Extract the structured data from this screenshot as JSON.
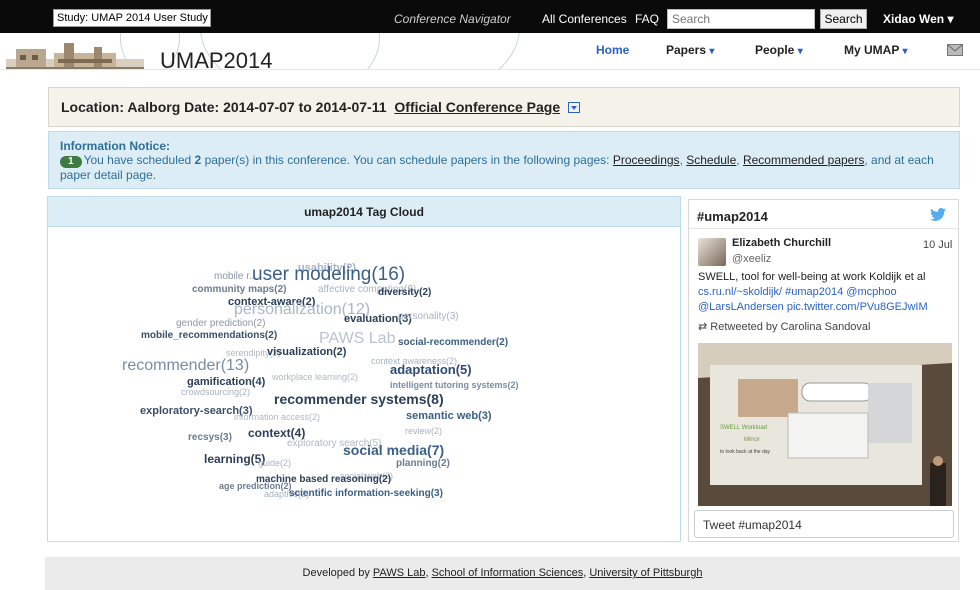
{
  "topbar": {
    "study_select": "Study: UMAP 2014 User Study",
    "conference_navigator": "Conference Navigator",
    "all_conferences": "All Conferences",
    "faq": "FAQ",
    "search_placeholder": "Search",
    "search_button": "Search",
    "user_name": "Xidao Wen ▾"
  },
  "header": {
    "title": "UMAP2014",
    "nav": {
      "home": "Home",
      "papers": "Papers",
      "people": "People",
      "my_umap": "My UMAP",
      "caret": "▾"
    }
  },
  "location": {
    "location_label": "Location:",
    "location_value": "Aalborg",
    "date_label": "Date:",
    "date_value": "2014-07-07 to 2014-07-11",
    "official_link": "Official Conference Page"
  },
  "notice": {
    "title": "Information Notice:",
    "badge": "1",
    "text_1": "You have scheduled ",
    "count": "2",
    "text_2": " paper(s) in this conference. You can schedule papers in the following pages: ",
    "link_proceedings": "Proceedings",
    "sep_1": ", ",
    "link_schedule": "Schedule",
    "sep_2": ", ",
    "link_recommended": "Recommended papers",
    "text_3": ", and at each paper detail page."
  },
  "tag_cloud": {
    "title": "umap2014 Tag Cloud",
    "tags": [
      {
        "label": "user modeling(16)",
        "color": "#3b5f86"
      },
      {
        "label": "mobile r...",
        "color": "#8a96a6"
      },
      {
        "label": "usability(2)",
        "color": "#a7b3c4"
      },
      {
        "label": "community maps(2)",
        "color": "#6b7c92"
      },
      {
        "label": "affective computing(2)",
        "color": "#a7b3c4"
      },
      {
        "label": "diversity(2)",
        "color": "#2c3e58"
      },
      {
        "label": "context-aware(2)",
        "color": "#2c3e58"
      },
      {
        "label": "personalization(12)",
        "color": "#a9b7c8"
      },
      {
        "label": "evaluation(3)",
        "color": "#2c3e58"
      },
      {
        "label": "personality(3)",
        "color": "#a7b3c4"
      },
      {
        "label": "gender prediction(2)",
        "color": "#8a96a6"
      },
      {
        "label": "mobile_recommendations(2)",
        "color": "#3b4f69"
      },
      {
        "label": "PAWS Lab",
        "color": "#b9c3cf"
      },
      {
        "label": "social-recommender(2)",
        "color": "#3b5f86"
      },
      {
        "label": "serendipity(2)",
        "color": "#b0b8c4"
      },
      {
        "label": "visualization(2)",
        "color": "#2c3e58"
      },
      {
        "label": "recommender(13)",
        "color": "#7a8ca3"
      },
      {
        "label": "context awareness(2)",
        "color": "#a7b3c4"
      },
      {
        "label": "adaptation(5)",
        "color": "#2c4a72"
      },
      {
        "label": "gamification(4)",
        "color": "#2c3e58"
      },
      {
        "label": "workplace learning(2)",
        "color": "#b0b8c4"
      },
      {
        "label": "crowdsourcing(2)",
        "color": "#a7b3c4"
      },
      {
        "label": "intelligent tutoring systems(2)",
        "color": "#7a8ca3"
      },
      {
        "label": "recommender systems(8)",
        "color": "#2c3e58"
      },
      {
        "label": "exploratory-search(3)",
        "color": "#3b4f69"
      },
      {
        "label": "information access(2)",
        "color": "#b0b8c4"
      },
      {
        "label": "semantic web(3)",
        "color": "#3b5f86"
      },
      {
        "label": "recsys(3)",
        "color": "#6b7c92"
      },
      {
        "label": "context(4)",
        "color": "#2c3e58"
      },
      {
        "label": "review(2)",
        "color": "#a7b3c4"
      },
      {
        "label": "exploratory search(5)",
        "color": "#b0b8c4"
      },
      {
        "label": "social media(7)",
        "color": "#3b5f86"
      },
      {
        "label": "learning(5)",
        "color": "#2c3e58"
      },
      {
        "label": "guide(2)",
        "color": "#a7b3c4"
      },
      {
        "label": "planning(2)",
        "color": "#6b7c92"
      },
      {
        "label": "social web(2)",
        "color": "#a7b3c4"
      },
      {
        "label": "machine based reasoning(2)",
        "color": "#2c3e58"
      },
      {
        "label": "age prediction(2)",
        "color": "#6b7c92"
      },
      {
        "label": "adaptive(2)",
        "color": "#a7b3c4"
      },
      {
        "label": "scientific information-seeking(3)",
        "color": "#3b5f86"
      }
    ]
  },
  "twitter": {
    "hashtag": "#umap2014",
    "author_name": "Elizabeth Churchill",
    "author_handle": "@xeeliz",
    "date": "10 Jul",
    "text_line_1": "SWELL, tool for well-being at work  Koldijk et al",
    "text_line_2": "cs.ru.nl/~skoldijk/ #umap2014 @mcphoo",
    "text_line_3": "@LarsLAndersen pic.twitter.com/PVu8GEJwIM",
    "retweet": "Retweeted by Carolina Sandoval",
    "photo_caption_1": "SWELL Workload",
    "photo_caption_2": "Mirror",
    "photo_caption_3": "to look back at the day",
    "tweet_button": "Tweet #umap2014"
  },
  "footer": {
    "prefix": "Developed by ",
    "link_paws": "PAWS Lab",
    "sep_1": ", ",
    "link_sis": "School of Information Sciences",
    "sep_2": ", ",
    "link_pitt": "University of Pittsburgh"
  }
}
